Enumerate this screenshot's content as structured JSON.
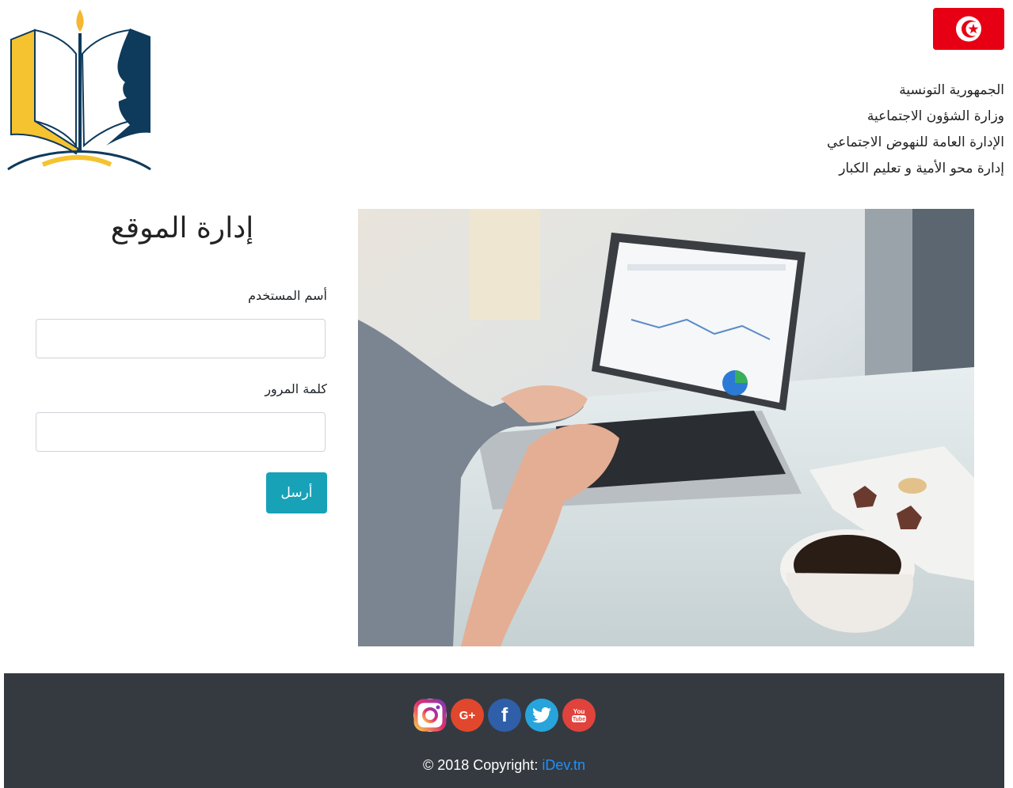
{
  "header": {
    "ministry_lines": [
      "الجمهورية التونسية",
      "وزارة الشؤون الاجتماعية",
      "الإدارة العامة للنهوض الاجتماعي",
      "إدارة محو الأمية و تعليم الكبار"
    ]
  },
  "form": {
    "title": "إدارة الموقع",
    "username_label": "أسم المستخدم",
    "username_value": "",
    "password_label": "كلمة المرور",
    "password_value": "",
    "submit_label": "أرسل"
  },
  "footer": {
    "social_icons": [
      "instagram-icon",
      "google-plus-icon",
      "facebook-icon",
      "twitter-icon",
      "youtube-icon"
    ],
    "copyright_prefix": "© 2018 Copyright:",
    "copyright_link": "iDev.tn"
  },
  "colors": {
    "accent": "#17a2b8",
    "footer_bg": "#343a40",
    "flag_red": "#e70013",
    "link": "#1e90ff"
  }
}
